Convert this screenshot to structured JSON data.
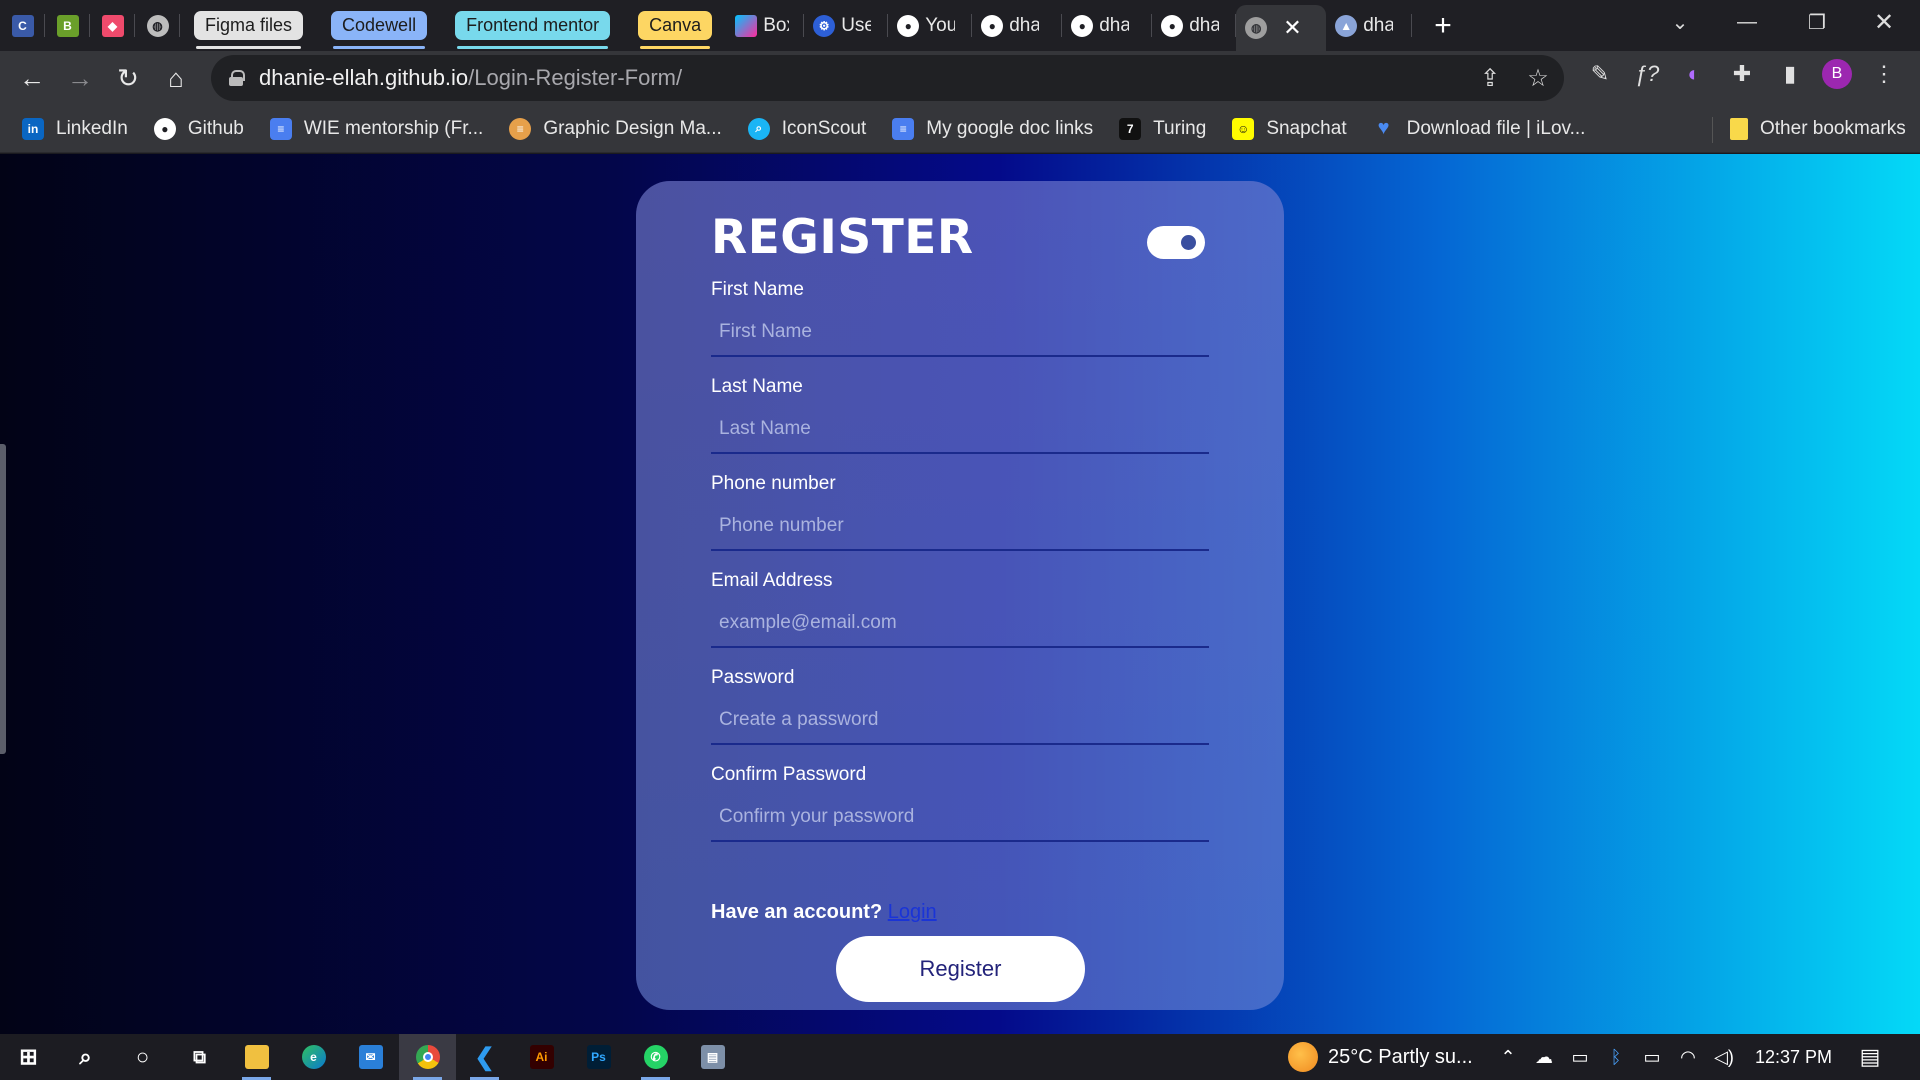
{
  "browser": {
    "tabs": {
      "group_figma": "Figma files",
      "group_codewell": "Codewell",
      "group_frontend": "Frontend mentor",
      "group_canva": "Canva",
      "box": "Box",
      "use": "Use",
      "you": "You",
      "dha1": "dha",
      "dha2": "dha",
      "dha3": "dha",
      "dha4": "dha"
    },
    "colors": {
      "figma_group": "#e3e3e3",
      "codewell_group": "#8ab4f8",
      "frontend_group": "#78d9ec",
      "canva_group": "#fdd663"
    },
    "url_host": "dhanie-ellah.github.io",
    "url_path": "/Login-Register-Form/",
    "profile_initial": "B"
  },
  "bookmarks": {
    "items": [
      "LinkedIn",
      "Github",
      "WIE mentorship (Fr...",
      "Graphic Design Ma...",
      "IconScout",
      "My google doc links",
      "Turing",
      "Snapchat",
      "Download file | iLov..."
    ],
    "other": "Other bookmarks"
  },
  "form": {
    "title": "REGISTER",
    "fields": [
      {
        "label": "First Name",
        "placeholder": "First Name"
      },
      {
        "label": "Last Name",
        "placeholder": "Last Name"
      },
      {
        "label": "Phone number",
        "placeholder": "Phone number"
      },
      {
        "label": "Email Address",
        "placeholder": "example@email.com"
      },
      {
        "label": "Password",
        "placeholder": "Create a password"
      },
      {
        "label": "Confirm Password",
        "placeholder": "Confirm your password"
      }
    ],
    "have_account": "Have an account?",
    "login_link": "Login",
    "register_button": "Register"
  },
  "taskbar": {
    "weather": "25°C  Partly su...",
    "time": "12:37 PM"
  }
}
